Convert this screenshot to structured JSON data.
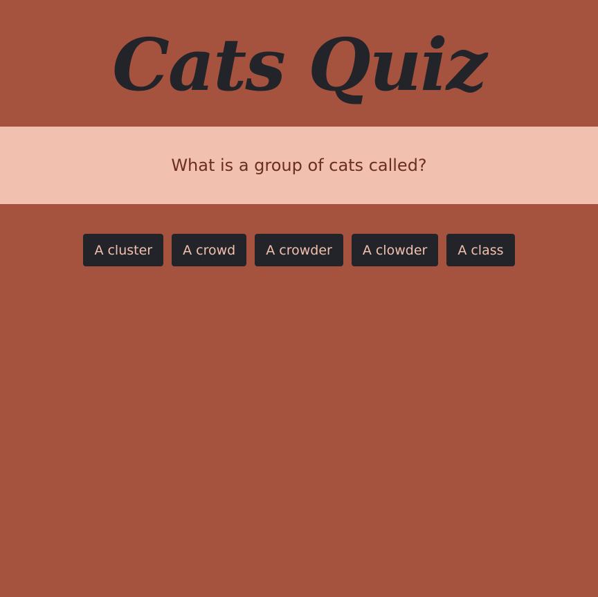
{
  "header": {
    "title": "Cats Quiz"
  },
  "question": {
    "text": "What is a group of cats called?"
  },
  "answers": [
    {
      "label": "A cluster"
    },
    {
      "label": "A crowd"
    },
    {
      "label": "A crowder"
    },
    {
      "label": "A clowder"
    },
    {
      "label": "A class"
    }
  ],
  "colors": {
    "page_background": "#A5523F",
    "question_band": "#F2C0AE",
    "question_text": "#6A2E22",
    "title_text": "#23242A",
    "button_background": "#23242A",
    "button_text": "#F2C0AE"
  }
}
